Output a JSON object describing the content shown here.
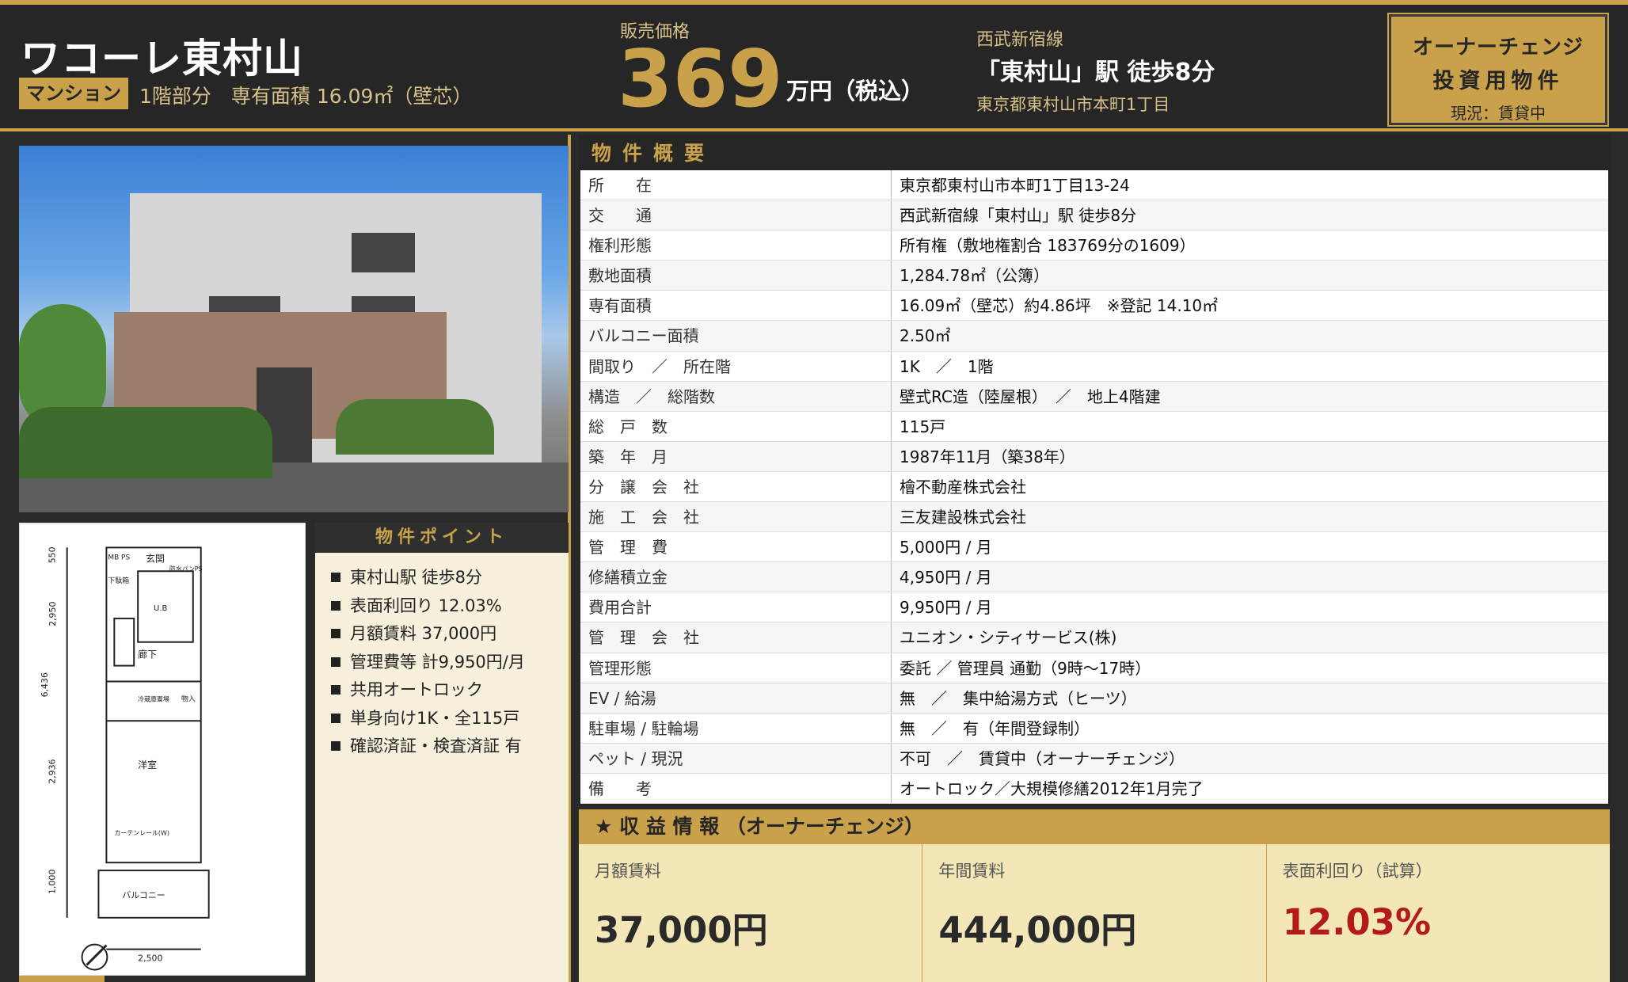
{
  "header": {
    "title": "ワコーレ東村山",
    "type_badge": "マンション",
    "detail": "1階部分　専有面積 16.09㎡（壁芯）",
    "price_label": "販売価格",
    "price": "369",
    "price_unit": "万円（税込）",
    "line": "西武新宿線",
    "station": "「東村山」駅 徒歩8分",
    "address": "東京都東村山市本町1丁目",
    "badge": {
      "line1": "オーナーチェンジ",
      "line2": "投資用物件",
      "line3": "現況：賃貸中"
    }
  },
  "photo": {
    "alt": "building-exterior-photo"
  },
  "floor_plan": {
    "dimensions": [
      "550",
      "2,950",
      "6,436",
      "2,936",
      "1,000",
      "2,500"
    ],
    "rooms": [
      "MB PS",
      "玄関",
      "下駄箱",
      "U.B",
      "廊下",
      "洋室",
      "バルコニー",
      "防水パン",
      "PS",
      "冷蔵庫置場",
      "物入",
      "カーテンレール(W)"
    ]
  },
  "points": {
    "title": "物件ポイント",
    "items": [
      "東村山駅 徒歩8分",
      "表面利回り 12.03%",
      "月額賃料 37,000円",
      "管理費等 計9,950円/月",
      "共用オートロック",
      "単身向け1K・全115戸",
      "確認済証・検査済証 有"
    ]
  },
  "overview": {
    "title": "物件概要",
    "rows": [
      {
        "k": "所　　在",
        "v": "東京都東村山市本町1丁目13-24"
      },
      {
        "k": "交　　通",
        "v": "西武新宿線「東村山」駅 徒歩8分"
      },
      {
        "k": "権利形態",
        "v": "所有権（敷地権割合 183769分の1609）"
      },
      {
        "k": "敷地面積",
        "v": "1,284.78㎡（公簿）"
      },
      {
        "k": "専有面積",
        "v": "16.09㎡（壁芯）約4.86坪　※登記 14.10㎡"
      },
      {
        "k": "バルコニー面積",
        "v": "2.50㎡"
      },
      {
        "k": "間取り　／　所在階",
        "v": "1K　／　1階"
      },
      {
        "k": "構造　／　総階数",
        "v": "壁式RC造（陸屋根）　／　地上4階建"
      },
      {
        "k": "総　戸　数",
        "v": "115戸"
      },
      {
        "k": "築　年　月",
        "v": "1987年11月（築38年）"
      },
      {
        "k": "分　譲　会　社",
        "v": "檜不動産株式会社"
      },
      {
        "k": "施　工　会　社",
        "v": "三友建設株式会社"
      },
      {
        "k": "管　理　費",
        "v": "5,000円 / 月"
      },
      {
        "k": "修繕積立金",
        "v": "4,950円 / 月"
      },
      {
        "k": "費用合計",
        "v": "9,950円 / 月"
      },
      {
        "k": "管　理　会　社",
        "v": "ユニオン・シティサービス(株)"
      },
      {
        "k": "管理形態",
        "v": "委託 ／ 管理員 通勤（9時～17時）"
      },
      {
        "k": "EV / 給湯",
        "v": "無　／　集中給湯方式（ヒーツ）"
      },
      {
        "k": "駐車場 / 駐輪場",
        "v": "無　／　有（年間登録制）"
      },
      {
        "k": "ペット / 現況",
        "v": "不可　／　賃貸中（オーナーチェンジ）"
      },
      {
        "k": "備　　考",
        "v": "オートロック／大規模修繕2012年1月完了"
      }
    ]
  },
  "income": {
    "title": "★ 収 益 情 報 （オーナーチェンジ）",
    "cols": [
      {
        "label": "月額賃料",
        "value": "37,000円"
      },
      {
        "label": "年間賃料",
        "value": "444,000円"
      },
      {
        "label": "表面利回り（試算）",
        "value": "12.03%"
      }
    ]
  },
  "colors": {
    "gold": "#c9a14a",
    "dark": "#262626",
    "red": "#b31b1b"
  }
}
